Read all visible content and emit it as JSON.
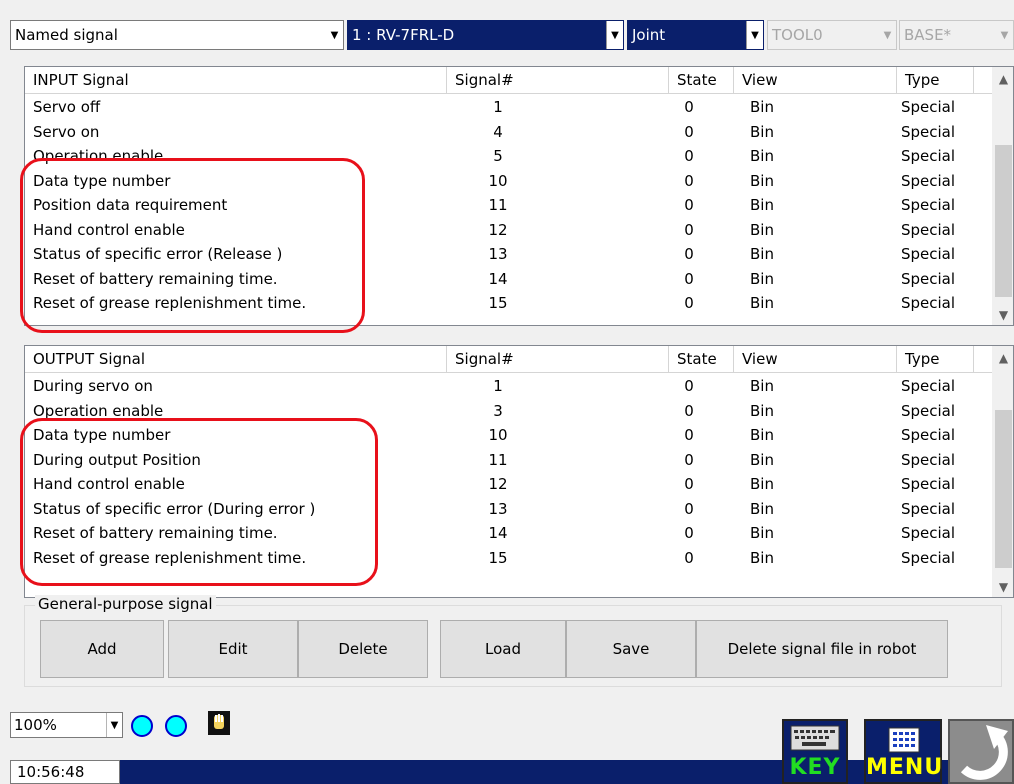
{
  "toolbar": {
    "mode": "Named signal",
    "robot": "1 : RV-7FRL-D",
    "jog": "Joint",
    "tool": "TOOL0",
    "base": "BASE*"
  },
  "columns": {
    "state": "State",
    "signal_no": "Signal#",
    "view": "View",
    "type": "Type"
  },
  "input_panel": {
    "title": "INPUT Signal",
    "rows": [
      {
        "name": "Servo off",
        "signal": "1",
        "state": "0",
        "view": "Bin",
        "type": "Special"
      },
      {
        "name": "Servo on",
        "signal": "4",
        "state": "0",
        "view": "Bin",
        "type": "Special"
      },
      {
        "name": "Operation enable",
        "signal": "5",
        "state": "0",
        "view": "Bin",
        "type": "Special"
      },
      {
        "name": "Data type number",
        "signal": "10",
        "state": "0",
        "view": "Bin",
        "type": "Special"
      },
      {
        "name": "Position data requirement",
        "signal": "11",
        "state": "0",
        "view": "Bin",
        "type": "Special"
      },
      {
        "name": "Hand control enable",
        "signal": "12",
        "state": "0",
        "view": "Bin",
        "type": "Special"
      },
      {
        "name": "Status of specific error (Release )",
        "signal": "13",
        "state": "0",
        "view": "Bin",
        "type": "Special"
      },
      {
        "name": "Reset of battery remaining time.",
        "signal": "14",
        "state": "0",
        "view": "Bin",
        "type": "Special"
      },
      {
        "name": "Reset of grease replenishment time.",
        "signal": "15",
        "state": "0",
        "view": "Bin",
        "type": "Special"
      }
    ]
  },
  "output_panel": {
    "title": "OUTPUT Signal",
    "rows": [
      {
        "name": "During servo on",
        "signal": "1",
        "state": "0",
        "view": "Bin",
        "type": "Special"
      },
      {
        "name": "Operation enable",
        "signal": "3",
        "state": "0",
        "view": "Bin",
        "type": "Special"
      },
      {
        "name": "Data type number",
        "signal": "10",
        "state": "0",
        "view": "Bin",
        "type": "Special"
      },
      {
        "name": "During output Position",
        "signal": "11",
        "state": "0",
        "view": "Bin",
        "type": "Special"
      },
      {
        "name": "Hand control enable",
        "signal": "12",
        "state": "0",
        "view": "Bin",
        "type": "Special"
      },
      {
        "name": "Status of specific error (During error )",
        "signal": "13",
        "state": "0",
        "view": "Bin",
        "type": "Special"
      },
      {
        "name": "Reset of battery remaining time.",
        "signal": "14",
        "state": "0",
        "view": "Bin",
        "type": "Special"
      },
      {
        "name": "Reset of grease replenishment time.",
        "signal": "15",
        "state": "0",
        "view": "Bin",
        "type": "Special"
      }
    ]
  },
  "general": {
    "label": "General-purpose signal",
    "buttons": {
      "add": "Add",
      "edit": "Edit",
      "delete": "Delete",
      "load": "Load",
      "save": "Save",
      "delete_file": "Delete signal file in robot"
    }
  },
  "footer": {
    "zoom": "100%",
    "time": "10:56:48",
    "key_label": "KEY",
    "menu_label": "MENU"
  },
  "colors": {
    "highlight": "#e8101a",
    "selection": "#0a1f6b",
    "led": "#00ffff",
    "key_label": "#22dd22",
    "menu_label": "#ffff00"
  }
}
